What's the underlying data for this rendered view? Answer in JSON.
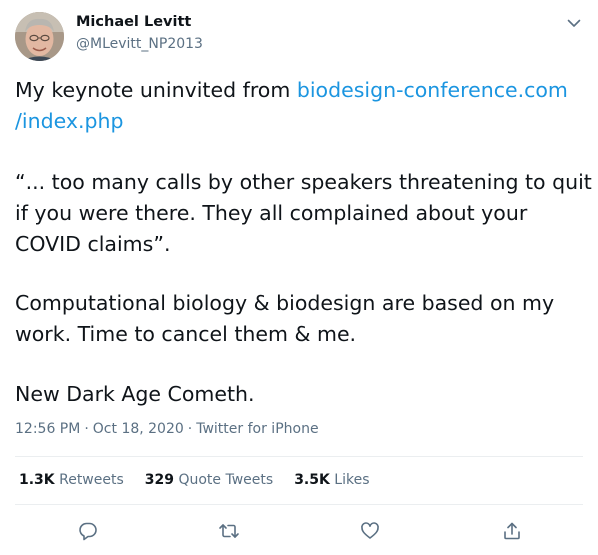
{
  "author": {
    "name": "Michael Levitt",
    "handle": "@MLevitt_NP2013"
  },
  "tweet": {
    "line1_prefix": "My keynote uninvited from ",
    "link_part1": "biodesign-conference.com",
    "link_part2": "/index.php",
    "para2_line1": "“... too many calls by other speakers threatening to quit",
    "para2_line2": "if you were there. They all complained about your",
    "para2_line3": "COVID claims”.",
    "para3_line1": "Computational biology & biodesign are based on my",
    "para3_line2": "work. Time to cancel them & me.",
    "para4_line1": "New Dark Age Cometh."
  },
  "meta": {
    "time": "12:56 PM",
    "separator": "·",
    "date": "Oct 18, 2020",
    "source": "Twitter for iPhone"
  },
  "stats": {
    "retweets_count": "1.3K",
    "retweets_label": "Retweets",
    "quotes_count": "329",
    "quotes_label": "Quote Tweets",
    "likes_count": "3.5K",
    "likes_label": "Likes"
  },
  "icons": {
    "caret": "chevron-down-icon",
    "reply": "reply-icon",
    "retweet": "retweet-icon",
    "like": "heart-icon",
    "share": "share-icon"
  },
  "colors": {
    "text": "#0f1419",
    "secondary": "#5b7083",
    "link": "#1b95e0",
    "divider": "#ebeef0"
  }
}
